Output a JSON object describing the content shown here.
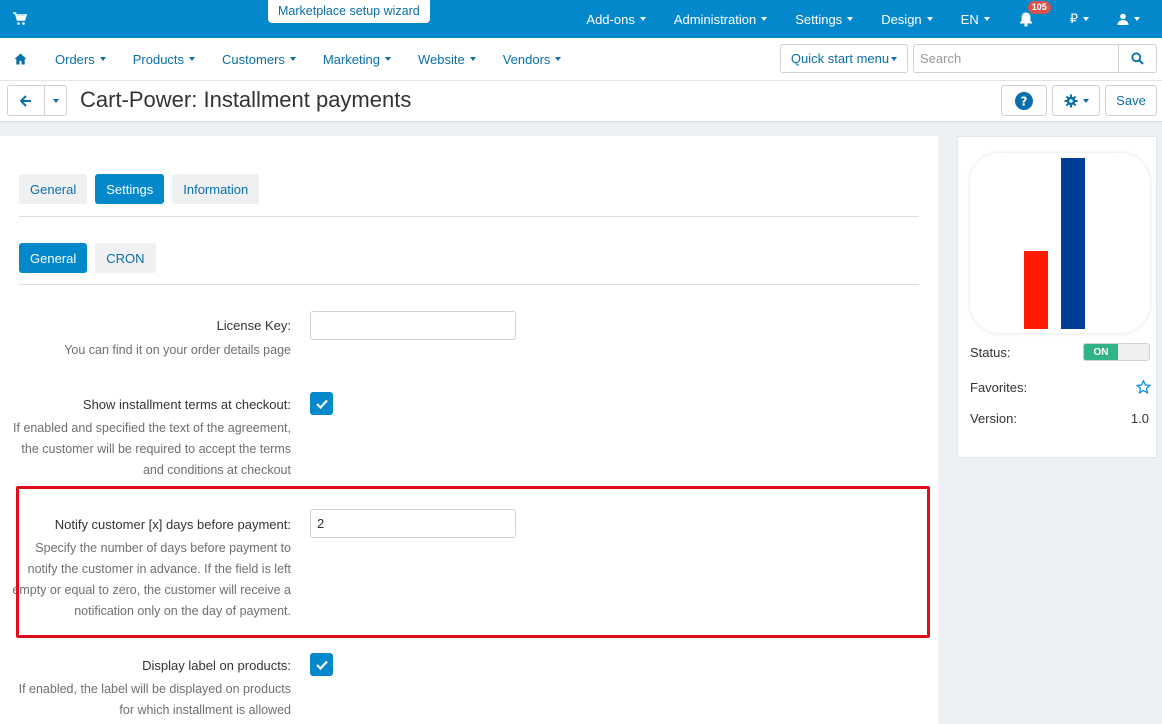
{
  "topbar": {
    "wizard_label": "Marketplace setup wizard",
    "menu": [
      "Add-ons",
      "Administration",
      "Settings",
      "Design",
      "EN"
    ],
    "notifications_count": "105",
    "currency": "₽"
  },
  "nav": {
    "items": [
      "Orders",
      "Products",
      "Customers",
      "Marketing",
      "Website",
      "Vendors"
    ],
    "quick_start": "Quick start menu",
    "search_placeholder": "Search"
  },
  "header": {
    "title": "Cart-Power: Installment payments",
    "save_label": "Save"
  },
  "tabs": {
    "main": [
      {
        "label": "General",
        "active": false
      },
      {
        "label": "Settings",
        "active": true
      },
      {
        "label": "Information",
        "active": false
      }
    ],
    "sub": [
      {
        "label": "General",
        "active": true
      },
      {
        "label": "CRON",
        "active": false
      }
    ]
  },
  "settings": {
    "license": {
      "label": "License Key:",
      "help": "You can find it on your order details page",
      "value": ""
    },
    "terms": {
      "label": "Show installment terms at checkout:",
      "help": [
        "If enabled and specified the text of the agreement,",
        "the customer will be required to accept the terms",
        "and conditions at checkout"
      ],
      "checked": true
    },
    "notify": {
      "label": "Notify customer [x] days before payment:",
      "help": [
        "Specify the number of days before payment to",
        "notify the customer in advance. If the field is left",
        "empty or equal to zero, the customer will receive a",
        "notification only on the day of payment."
      ],
      "value": "2"
    },
    "display_label": {
      "label": "Display label on products:",
      "help": [
        "If enabled, the label will be displayed on products",
        "for which installment is allowed"
      ],
      "checked": true
    }
  },
  "sidebar": {
    "status_label": "Status:",
    "status_value": "ON",
    "favorites_label": "Favorites:",
    "version_label": "Version:",
    "version_value": "1.0"
  },
  "colors": {
    "accent": "#0388cc",
    "highlight": "#e00d1c",
    "status_on": "#32b287",
    "logo_red": "#ff1a00",
    "logo_blue": "#003d99"
  }
}
